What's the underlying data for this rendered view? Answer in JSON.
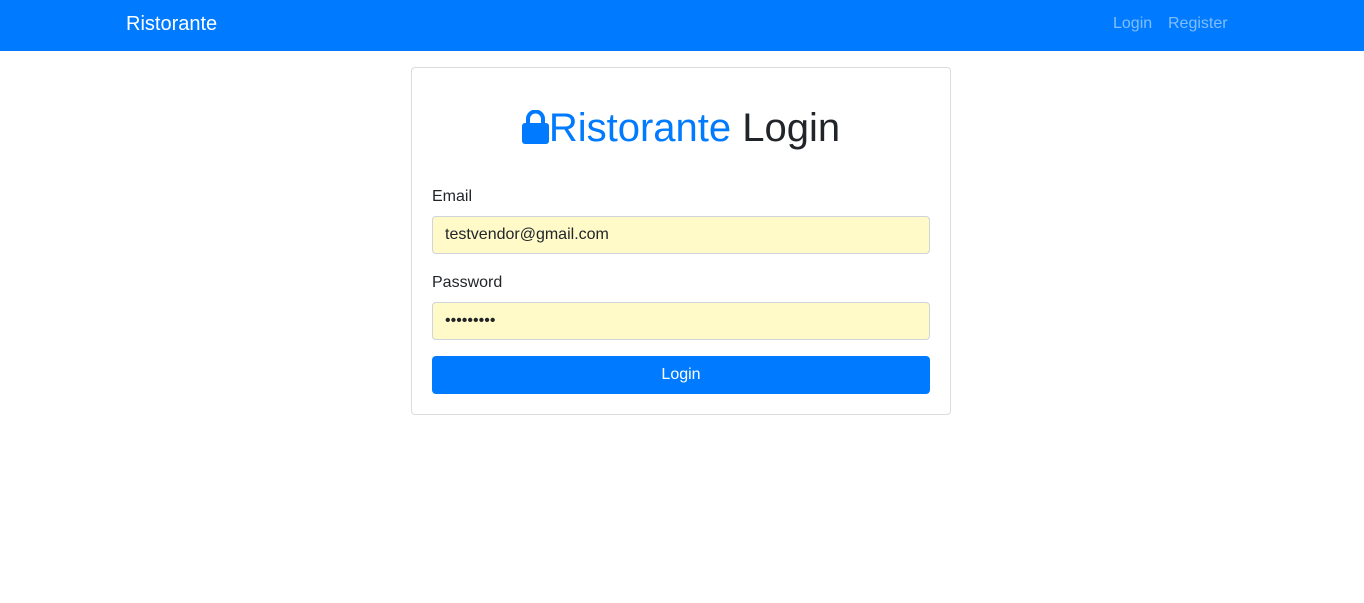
{
  "navbar": {
    "brand": "Ristorante",
    "links": {
      "login": "Login",
      "register": "Register"
    },
    "color": "#007bff"
  },
  "card": {
    "title_icon": "lock-icon",
    "title_brand": "Ristorante",
    "title_rest": " Login",
    "email": {
      "label": "Email",
      "value": "testvendor@gmail.com"
    },
    "password": {
      "label": "Password",
      "value": "•••••••••"
    },
    "submit_label": "Login"
  },
  "colors": {
    "primary": "#007bff",
    "autofill_background": "#fffac8"
  }
}
